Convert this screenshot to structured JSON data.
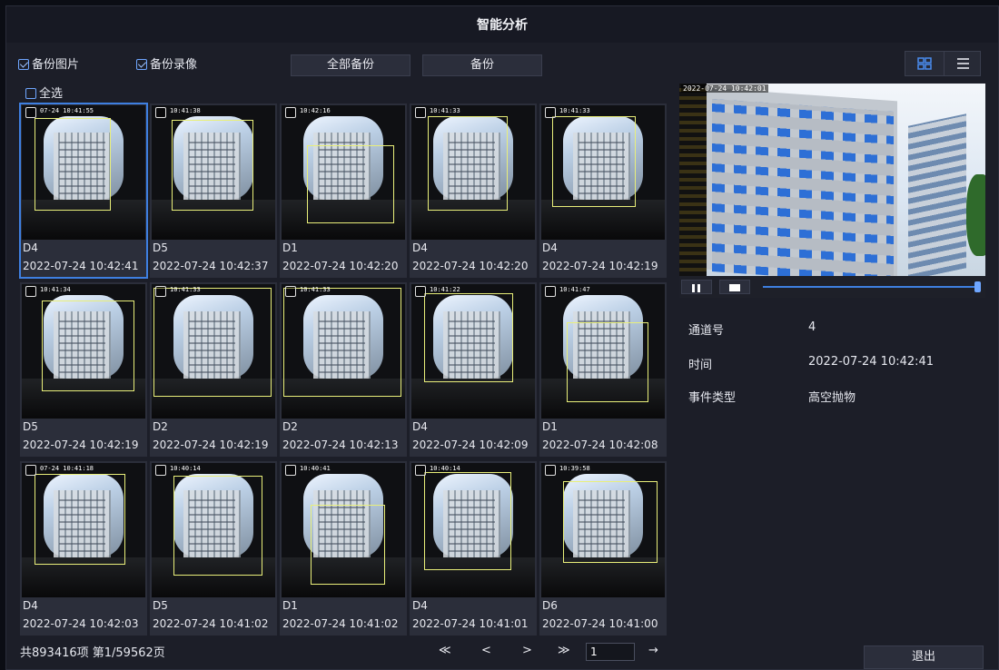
{
  "title": "智能分析",
  "toolbar": {
    "backup_image_label": "备份图片",
    "backup_video_label": "备份录像",
    "backup_all_label": "全部备份",
    "backup_label": "备份",
    "select_all_label": "全选"
  },
  "view_switch": {
    "grid_icon": "grid-icon",
    "list_icon": "list-icon",
    "active": "grid"
  },
  "items": [
    {
      "channel": "D4",
      "time": "2022-07-24 10:42:41",
      "thumb_ts": "07-24 10:41:55",
      "selected": true
    },
    {
      "channel": "D5",
      "time": "2022-07-24 10:42:37",
      "thumb_ts": "10:41:38",
      "selected": false
    },
    {
      "channel": "D1",
      "time": "2022-07-24 10:42:20",
      "thumb_ts": "10:42:16",
      "selected": false
    },
    {
      "channel": "D4",
      "time": "2022-07-24 10:42:20",
      "thumb_ts": "10:41:33",
      "selected": false
    },
    {
      "channel": "D4",
      "time": "2022-07-24 10:42:19",
      "thumb_ts": "10:41:33",
      "selected": false
    },
    {
      "channel": "D5",
      "time": "2022-07-24 10:42:19",
      "thumb_ts": "10:41:34",
      "selected": false
    },
    {
      "channel": "D2",
      "time": "2022-07-24 10:42:19",
      "thumb_ts": "10:41:33",
      "selected": false
    },
    {
      "channel": "D2",
      "time": "2022-07-24 10:42:13",
      "thumb_ts": "10:41:33",
      "selected": false
    },
    {
      "channel": "D4",
      "time": "2022-07-24 10:42:09",
      "thumb_ts": "10:41:22",
      "selected": false
    },
    {
      "channel": "D1",
      "time": "2022-07-24 10:42:08",
      "thumb_ts": "10:41:47",
      "selected": false
    },
    {
      "channel": "D4",
      "time": "2022-07-24 10:42:03",
      "thumb_ts": "07-24 10:41:18",
      "selected": false
    },
    {
      "channel": "D5",
      "time": "2022-07-24 10:41:02",
      "thumb_ts": "10:40:14",
      "selected": false
    },
    {
      "channel": "D1",
      "time": "2022-07-24 10:41:02",
      "thumb_ts": "10:40:41",
      "selected": false
    },
    {
      "channel": "D4",
      "time": "2022-07-24 10:41:01",
      "thumb_ts": "10:40:14",
      "selected": false
    },
    {
      "channel": "D6",
      "time": "2022-07-24 10:41:00",
      "thumb_ts": "10:39:58",
      "selected": false
    }
  ],
  "preview": {
    "timestamp": "2022-07-24 10:42:01",
    "progress": 1.0
  },
  "details": {
    "channel_label": "通道号",
    "channel_value": "4",
    "time_label": "时间",
    "time_value": "2022-07-24 10:42:41",
    "event_label": "事件类型",
    "event_value": "高空抛物"
  },
  "pagination": {
    "summary": "共893416项  第1/59562页",
    "first": "≪",
    "prev": "<",
    "next": ">",
    "last": "≫",
    "page_input": "1",
    "go": "→"
  },
  "exit_label": "退出",
  "colors": {
    "accent": "#3e7fe0",
    "detection_box": "#e9ef7a",
    "background": "#1c1e28"
  }
}
